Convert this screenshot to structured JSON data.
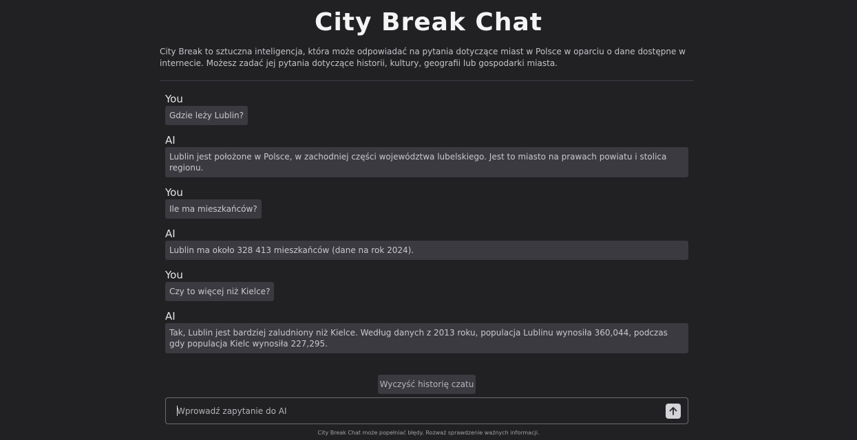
{
  "header": {
    "title": "City Break Chat",
    "intro": "City Break to sztuczna inteligencja, która może odpowiadać na pytania dotyczące miast w Polsce w oparciu o dane dostępne w internecie. Możesz zadać jej pytania dotyczące historii, kultury, geografii lub gospodarki miasta."
  },
  "chat": {
    "messages": [
      {
        "sender": "You",
        "text": "Gdzie leży Lublin?"
      },
      {
        "sender": "AI",
        "text": "Lublin jest położone w Polsce, w zachodniej części województwa lubelskiego. Jest to miasto na prawach powiatu i stolica regionu."
      },
      {
        "sender": "You",
        "text": "Ile ma mieszkańców?"
      },
      {
        "sender": "AI",
        "text": "Lublin ma około 328 413 mieszkańców (dane na rok 2024)."
      },
      {
        "sender": "You",
        "text": "Czy to więcej niż Kielce?"
      },
      {
        "sender": "AI",
        "text": "Tak, Lublin jest bardziej zaludniony niż Kielce. Według danych z 2013 roku, populacja Lublinu wynosiła 360,044, podczas gdy populacja Kielc wynosiła 227,295."
      }
    ]
  },
  "controls": {
    "clear_label": "Wyczyść historię czatu",
    "input_placeholder": "Wprowadź zapytanie do AI",
    "input_value": "",
    "send_icon": "arrow-up-icon"
  },
  "footer": {
    "disclaimer": "City Break Chat może popełniać błędy. Rozważ sprawdzenie ważnych informacji."
  },
  "colors": {
    "background": "#212124",
    "bubble": "#3a3a40",
    "text": "#d4d4d8",
    "title": "#f4f4f5"
  }
}
